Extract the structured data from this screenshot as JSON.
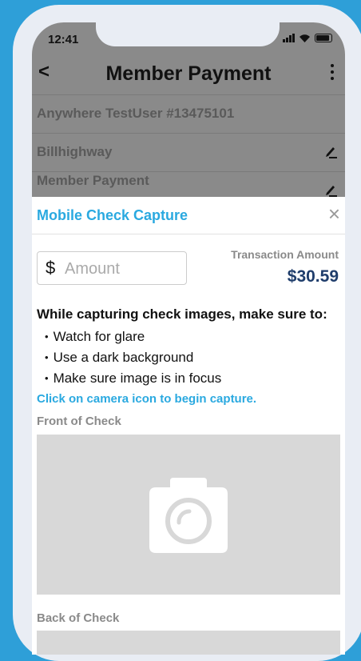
{
  "status_bar": {
    "time": "12:41"
  },
  "header": {
    "back_glyph": "<",
    "title": "Member Payment",
    "menu_icon": "more-vertical-icon"
  },
  "background_rows": [
    {
      "label": "Anywhere TestUser #13475101"
    },
    {
      "label": "Billhighway",
      "icon": "edit-icon"
    },
    {
      "label": "Member Payment",
      "icon": "edit-icon"
    }
  ],
  "modal": {
    "title": "Mobile Check Capture",
    "close_glyph": "×",
    "amount": {
      "currency": "$",
      "placeholder": "Amount",
      "value": ""
    },
    "transaction_label": "Transaction Amount",
    "transaction_amount": "$30.59",
    "instructions_title": "While capturing check images, make sure to:",
    "instructions": [
      "Watch for glare",
      "Use a dark background",
      "Make sure image is in focus"
    ],
    "capture_hint": "Click on camera icon to begin capture.",
    "front_label": "Front of Check",
    "back_label": "Back of Check",
    "camera_icon": "camera-icon"
  },
  "colors": {
    "accent": "#2aa9e0",
    "amount": "#1f3d6b",
    "background": "#2e9fd8"
  }
}
